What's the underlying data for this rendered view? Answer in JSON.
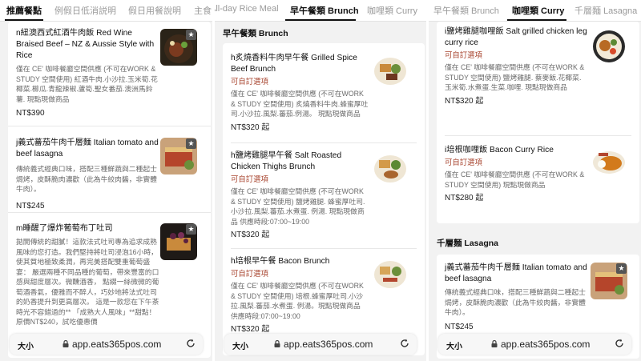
{
  "panels": [
    {
      "tabs": [
        "推薦餐點",
        "例假日低消説明",
        "假日用餐說明",
        "主食"
      ],
      "active_tab": 0,
      "items": [
        {
          "name": "n紐澳西式紅酒牛肉飯 Red Wine Braised Beef – NZ & Aussie Style with Rice",
          "desc": "僅在 CE' 咖啡餐廳空間供應 (不可在WORK & STUDY 空間使用) 紅酒牛肉.小沙拉.玉米筍.花椰菜.櫛瓜.青龍辣椒.蘆筍.聖女番茄.澳洲馬鈴薯. 現點現做商品",
          "price": "NT$390"
        },
        {
          "name": "j義式蕃茄牛肉千層麵 Italian tomato and beef lasagna",
          "desc": "傳統義式經典口味，搭配三種鮮蔬與二種起士焗烤，皮酥脆肉濃歡（此為牛絞肉醬，非實體牛肉）。",
          "price": "NT$245"
        },
        {
          "name": "m睡醒了爆炸葡萄布丁吐司",
          "desc": "拋開傳統的甜膩！這款法式吐司專為追求成熟風味的您打造。我們堅持將吐司浸泡16小時，使其質地極致柔潤，再完美搭配雙重葡萄盛宴： 嚴選兩種不同品種的葡萄，帶來豐富的口感與甜度層次。微醺酒香， 點綴一絲微微的葡萄酒香氣，優雅而不醉人，巧妙地將法式吐司的奶香提升到更高層次。 這是一款您在下午茶時光不容錯過的** 「成熟大人風味」**甜點！原價NT$240，試吃優惠價"
        }
      ],
      "url": "app.eats365pos.com",
      "aa": "大小"
    },
    {
      "tabs": [
        "All-day Rice Meal",
        "早午餐類 Brunch",
        "咖哩類 Curry"
      ],
      "active_tab": 1,
      "category": "早午餐類 Brunch",
      "items": [
        {
          "name": "h炙燒香料牛肉早午餐 Grilled Spice Beef Brunch",
          "tag": "可自訂選項",
          "desc": "僅在 CE' 咖啡餐廳空間供應 (不可在WORK & STUDY 空間使用) 炙燒香料牛肉.蜂蜜厚吐司.小沙拉.風梨.蕃茄.例湯。 現點現做商品",
          "price": "NT$320 起"
        },
        {
          "name": "h鹽烤雞腿早午餐 Salt Roasted Chicken Thighs Brunch",
          "tag": "可自訂選項",
          "desc": "僅在 CE' 咖啡餐廳空間供應 (不可在WORK & STUDY 空間使用) 鹽烤雞腿. 蜂蜜厚吐司.小沙拉.風梨.蕃茄.水煮蛋. 例湯. 現點現做商品 供應時段:07:00~19:00",
          "price": "NT$320 起"
        },
        {
          "name": "h培根早午餐 Bacon Brunch",
          "tag": "可自訂選項",
          "desc": "僅在 CE' 咖啡餐廳空間供應 (不可在WORK & STUDY 空間使用) 培根.蜂蜜厚吐司.小沙拉.風梨.蕃茄.水煮蛋. 例湯。現點現做商品 供應時段:07:00~19:00",
          "price": "NT$320 起"
        }
      ],
      "url": "app.eats365pos.com",
      "aa": "大小"
    },
    {
      "tabs": [
        "早午餐類 Brunch",
        "咖哩類 Curry",
        "千層麵 Lasagna"
      ],
      "active_tab": 1,
      "category": "千層麵 Lasagna",
      "items": [
        {
          "name": "i鹽烤雞腿咖哩飯 Salt grilled chicken leg curry rice",
          "tag": "可自訂選項",
          "desc": "僅在 CE' 咖啡餐廳空間供應 (不可在WORK & STUDY 空間使用) 鹽烤雞腿. 蔡麥飯.花椰菜.玉米筍.水煮蛋.生菜.咖哩. 現點現做商品",
          "price": "NT$320 起"
        },
        {
          "name": "i培根咖哩飯 Bacon Curry Rice",
          "tag": "可自訂選項",
          "desc": "僅在 CE' 咖啡餐廳空間供應 (不可在WORK & STUDY 空間使用) 現點現做商品",
          "price": "NT$280 起"
        },
        {
          "name": "j義式蕃茄牛肉千層麵 Italian tomato and beef lasagna",
          "desc": "傳統義式經典口味，搭配三種鮮蔬與二種起士焗烤，皮酥脆肉濃歡（此為牛絞肉醬，非實體牛肉）。",
          "price": "NT$245"
        }
      ],
      "url": "app.eats365pos.com",
      "aa": "大小"
    }
  ],
  "colors": {
    "tag": "#a8452f",
    "active_tab": "#111111",
    "inactive_tab": "#9a9a9a"
  }
}
